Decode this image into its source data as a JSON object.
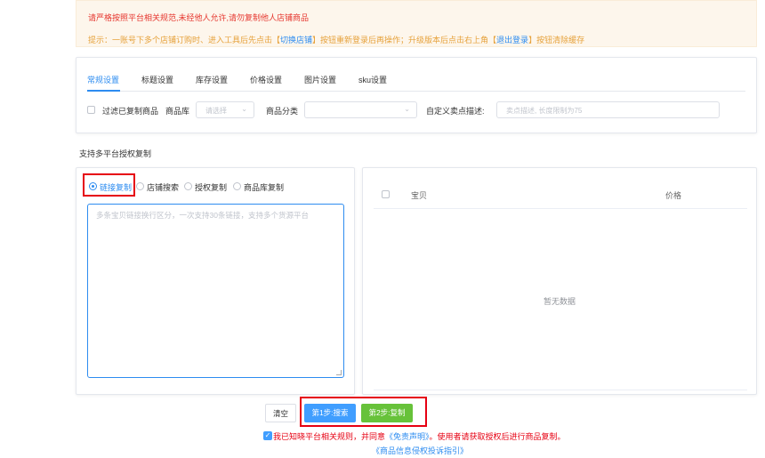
{
  "notice": {
    "line1": "请严格按照平台相关规范,未经他人允许,请勿复制他人店铺商品",
    "line2_pre": "提示：一账号下多个店铺订购时、进入工具后先点击【",
    "switch_shop": "切换店铺",
    "line2_mid": "】按钮重新登录后再操作；升级版本后点击右上角【",
    "logout": "退出登录",
    "line2_post": "】按钮清除缓存"
  },
  "tabs": [
    "常规设置",
    "标题设置",
    "库存设置",
    "价格设置",
    "图片设置",
    "sku设置"
  ],
  "filters": {
    "filter_copied_label": "过滤已复制商品",
    "library_label": "商品库",
    "library_placeholder": "请选择",
    "category_label": "商品分类",
    "custom_desc_label": "自定义卖点描述:",
    "custom_desc_placeholder": "卖点描述, 长度限制为75"
  },
  "section_title": "支持多平台授权复制",
  "copy_modes": [
    "链接复制",
    "店铺搜索",
    "授权复制",
    "商品库复制"
  ],
  "selected_mode": "链接复制",
  "link_textarea_placeholder": "多条宝贝链接换行区分，一次支持30条链接，支持多个货源平台",
  "table": {
    "col_item": "宝贝",
    "col_price": "价格",
    "empty_text": "暂无数据"
  },
  "buttons": {
    "clear": "清空",
    "step1": "第1步:搜索",
    "step2": "第2步:复制"
  },
  "agreement": {
    "pre": "我已知晓平台相关规则，并同意",
    "disclaimer": "《免责声明》",
    "post": "。使用者请获取授权后进行商品复制。",
    "checked": true
  },
  "infringement_guide": "《商品信息侵权投诉指引》",
  "colors": {
    "primary": "#2d8cf0",
    "search_btn": "#409eff",
    "copy_btn": "#67c23a",
    "warning_red": "#e60012",
    "notice_bg": "#fdf6ec"
  }
}
